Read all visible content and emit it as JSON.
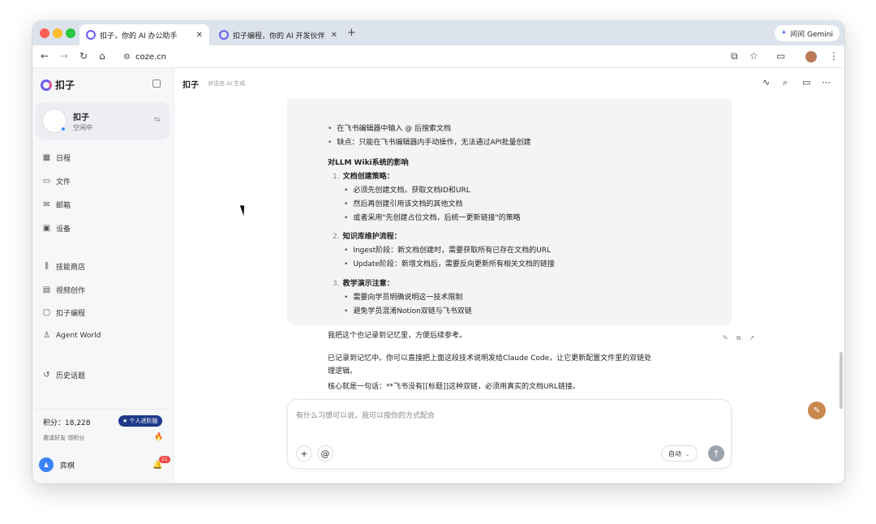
{
  "browser": {
    "tabs": [
      {
        "label": "扣子，你的 AI 办公助手"
      },
      {
        "label": "扣子编程，你的 AI 开发伙伴，"
      }
    ],
    "gemini_label": "问问 Gemini",
    "url": "coze.cn"
  },
  "sidebar": {
    "app_name": "扣子",
    "agent": {
      "name": "扣子",
      "status": "空闲中"
    },
    "nav_items": [
      {
        "icon": "calendar-icon",
        "label": "日程"
      },
      {
        "icon": "folder-icon",
        "label": "文件"
      },
      {
        "icon": "mail-icon",
        "label": "邮箱"
      },
      {
        "icon": "device-icon",
        "label": "设备"
      },
      {
        "icon": "store-icon",
        "label": "技能商店"
      },
      {
        "icon": "video-icon",
        "label": "视频创作"
      },
      {
        "icon": "code-icon",
        "label": "扣子编程"
      },
      {
        "icon": "globe-icon",
        "label": "Agent World"
      },
      {
        "icon": "history-icon",
        "label": "历史话题"
      }
    ],
    "points": {
      "label": "积分：18,228",
      "badge": "★ 个人进阶版",
      "invite": "邀请好友 领积分"
    },
    "user": {
      "name": "弈棋",
      "notif_count": "21"
    }
  },
  "main": {
    "title": "扣子",
    "subtitle": "对话由 AI 生成",
    "user_message": {
      "pre_bullets": [
        "在飞书编辑器中输入 @ 后搜索文档",
        "缺点：只能在飞书编辑器内手动操作，无法通过API批量创建"
      ],
      "impact_heading": "对LLM Wiki系统的影响",
      "sections": [
        {
          "num": "1.",
          "title": "文档创建策略：",
          "items": [
            "必须先创建文档，获取文档ID和URL",
            "然后再创建引用该文档的其他文档",
            "或者采用\"先创建占位文档，后统一更新链接\"的策略"
          ]
        },
        {
          "num": "2.",
          "title": "知识库维护流程：",
          "items": [
            "Ingest阶段：新文档创建时，需要获取所有已存在文档的URL",
            "Update阶段：新增文档后，需要反向更新所有相关文档的链接"
          ]
        },
        {
          "num": "3.",
          "title": "教学演示注意：",
          "items": [
            "需要向学员明确说明这一技术限制",
            "避免学员混淆Notion双链与飞书双链"
          ]
        }
      ],
      "closing": "我把这个也记录到记忆里，方便后续参考。"
    },
    "assistant_reply": {
      "line1": "已记录到记忆中。你可以直接把上面这段技术说明发给Claude Code，让它更新配置文件里的双链处",
      "line2": "理逻辑。",
      "line3": "核心就是一句话：**飞书没有[[标题]]这种双链，必须用真实的文档URL链接。"
    },
    "input": {
      "placeholder": "有什么习惯可以说，我可以按你的方式配合",
      "mode": "自动"
    }
  }
}
